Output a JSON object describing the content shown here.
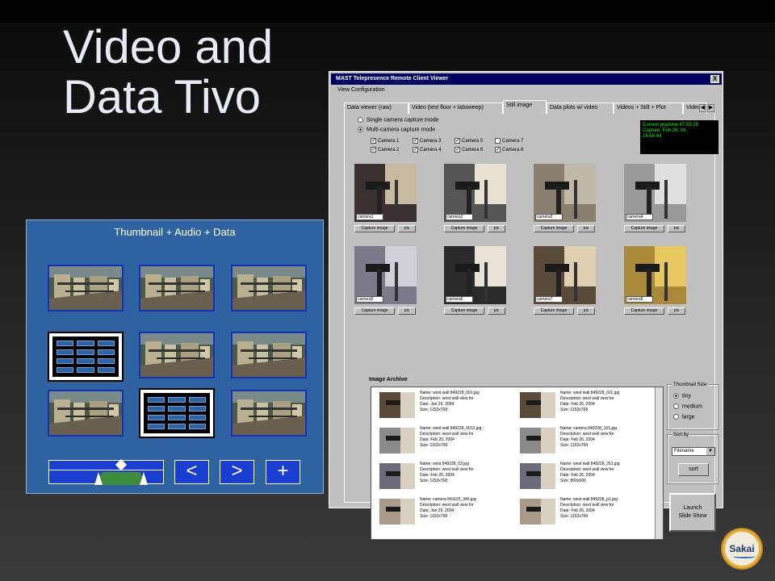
{
  "slide": {
    "title_line1": "Video and",
    "title_line2": "Data Tivo"
  },
  "mockup": {
    "caption": "Thumbnail + Audio + Data",
    "buttons": {
      "prev": "<",
      "next": ">",
      "add": "+"
    },
    "grid": [
      [
        "video",
        "video",
        "video"
      ],
      [
        "data",
        "video",
        "video"
      ],
      [
        "video",
        "data",
        "video"
      ]
    ]
  },
  "window": {
    "title": "MAST Telepresence Remote Client Viewer",
    "close": "X",
    "menu": "View Configuration",
    "tabs": [
      "Data viewer (raw)",
      "Video (test floor + labsweep)",
      "Still image",
      "Data plots w/ video",
      "Videos + Still + Plot",
      "Videos"
    ],
    "active_tab": 2,
    "modes": {
      "single": "Single camera capture mode",
      "multi": "Multi-camera capture mode",
      "selected": "multi"
    },
    "cameras": [
      {
        "label": "Camera 1",
        "checked": true
      },
      {
        "label": "Camera 3",
        "checked": true
      },
      {
        "label": "Camera 5",
        "checked": true
      },
      {
        "label": "Camera 7",
        "checked": false
      },
      {
        "label": "Camera 2",
        "checked": true
      },
      {
        "label": "Camera 4",
        "checked": true
      },
      {
        "label": "Camera 6",
        "checked": true
      },
      {
        "label": "Camera 8",
        "checked": true
      }
    ],
    "status": {
      "line1": "Current playtime 47:55:29",
      "line2": "Capture: Feb 26, 04,",
      "line3": "16:54:44"
    },
    "captures": [
      {
        "label": "camera1",
        "capture": "Capture image",
        "file": "pic"
      },
      {
        "label": "camera2",
        "capture": "Capture image",
        "file": "pic"
      },
      {
        "label": "camera3",
        "capture": "Capture image",
        "file": "pic"
      },
      {
        "label": "camera4",
        "capture": "Capture image",
        "file": "pic"
      },
      {
        "label": "camera5",
        "capture": "Capture image",
        "file": "pic"
      },
      {
        "label": "camera6",
        "capture": "Capture image",
        "file": "pic"
      },
      {
        "label": "camera7",
        "capture": "Capture image",
        "file": "pic"
      },
      {
        "label": "camera8",
        "capture": "Capture image",
        "file": "pic"
      }
    ],
    "archive": {
      "label": "Image Archive",
      "entries": [
        {
          "name": "Name: west wall 849228_001.jpg",
          "desc": "Description: west wall view for",
          "date": "Date: Jan 26, 2004",
          "size": "Size: 1152x768"
        },
        {
          "name": "Name: west wall 849228_011.jpg",
          "desc": "Description: west wall view for",
          "date": "Date: Feb 26, 2004",
          "size": "Size: 1152x768"
        },
        {
          "name": "Name: west wall 849228_0012.jpg",
          "desc": "Description: west wall view for",
          "date": "Date: Feb 20, 2004",
          "size": "Size: 1152x768"
        },
        {
          "name": "Name: camera 849228_161.jpg",
          "desc": "Description: west wall view for",
          "date": "Date: Feb 26, 2004",
          "size": "Size: 1152x768"
        },
        {
          "name": "Name: west 849228_63.jpg",
          "desc": "Description: west wall view for",
          "date": "Date: Feb 20, 2004",
          "size": "Size: 1152x768"
        },
        {
          "name": "Name: west wall 849228_261.jpg",
          "desc": "Description: west wall view for",
          "date": "Date: Feb 26, 2004",
          "size": "Size: 800x600"
        },
        {
          "name": "Name: camera 841125_346.jpg",
          "desc": "Description: west wall view for",
          "date": "Date: Jan 26, 2004",
          "size": "Size: 1152x768"
        },
        {
          "name": "Name: west wall 849228_p1.jpg",
          "desc": "Description: west wall view for",
          "date": "Date: Feb 26, 2004",
          "size": "Size: 1152x768"
        }
      ]
    },
    "thumb_size": {
      "label": "Thumbnail Size",
      "options": [
        "tiny",
        "medium",
        "large"
      ],
      "selected": "tiny"
    },
    "sort": {
      "label": "Sort by",
      "value": "Filename",
      "button": "sort"
    },
    "launch": {
      "line1": "Launch",
      "line2": "Slide Show"
    }
  },
  "logo": {
    "text": "Sakai"
  }
}
